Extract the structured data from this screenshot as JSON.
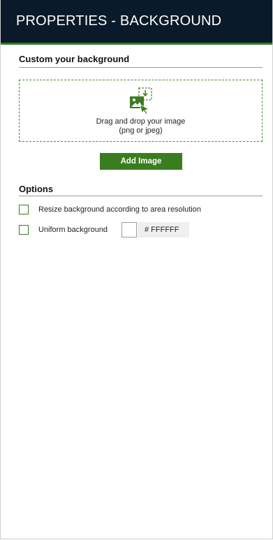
{
  "header": {
    "title": "PROPERTIES - BACKGROUND"
  },
  "custom_background": {
    "title": "Custom your background",
    "dropzone": {
      "icon": "image-upload-icon",
      "line1": "Drag and drop your image",
      "line2": "(png or jpeg)"
    },
    "add_button_label": "Add Image"
  },
  "options": {
    "title": "Options",
    "resize_label": "Resize background according to area resolution",
    "resize_checked": false,
    "uniform_label": "Uniform background",
    "uniform_checked": false,
    "color_value": "# FFFFFF",
    "color_swatch": "#FFFFFF"
  },
  "colors": {
    "header_bg": "#0B1A2A",
    "accent_green": "#3A7D1F"
  }
}
